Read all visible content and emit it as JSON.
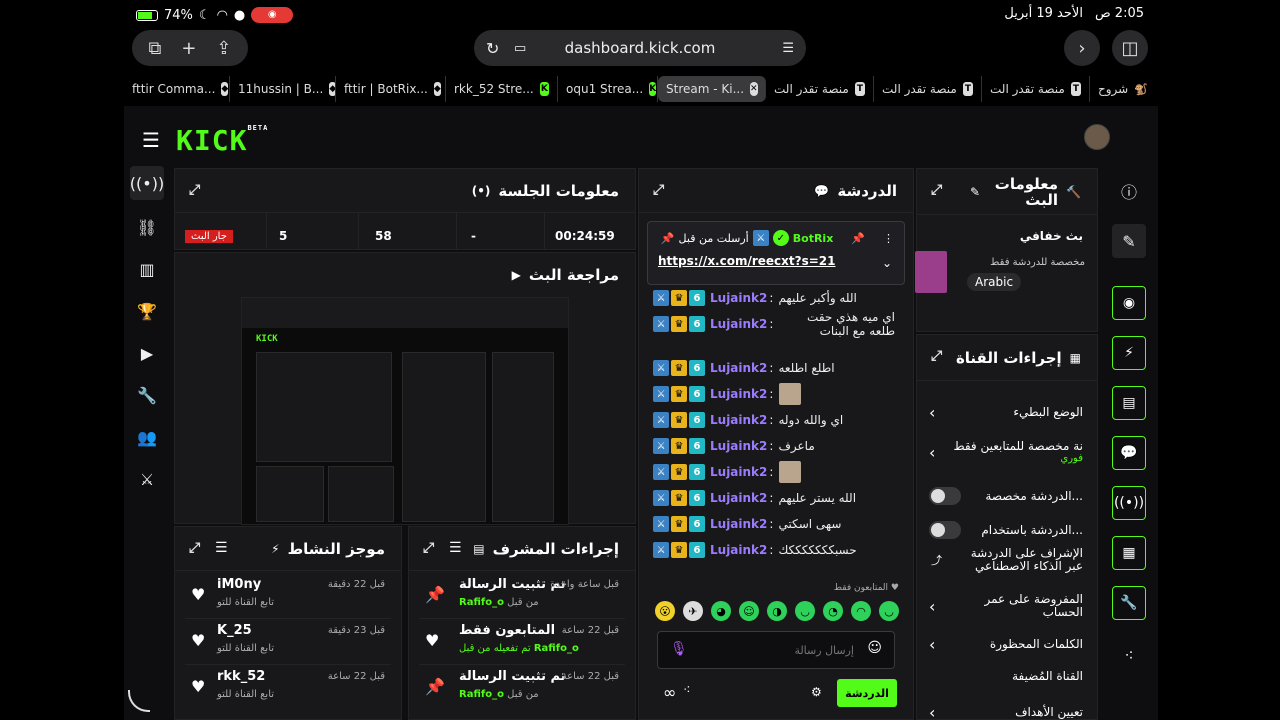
{
  "status": {
    "time": "2:05 ص",
    "date": "الأحد 19 أبريل",
    "battery": "74%"
  },
  "browser": {
    "url": "dashboard.kick.com"
  },
  "tabs": [
    {
      "label": "شروح",
      "icon": "🐒"
    },
    {
      "label": "منصة تقدر الت",
      "icon": "T"
    },
    {
      "label": "منصة تقدر الت",
      "icon": "T"
    },
    {
      "label": "منصة تقدر الت",
      "icon": "T"
    },
    {
      "label": "Stream - Ki...",
      "icon": "x"
    },
    {
      "label": "oqu1 Strea...",
      "icon": "K"
    },
    {
      "label": "rkk_52 Stre...",
      "icon": "K"
    },
    {
      "label": "fttir | BotRix...",
      "icon": "◆"
    },
    {
      "label": "11hussin | B...",
      "icon": "◆"
    },
    {
      "label": "fttir Comma...",
      "icon": "◆"
    }
  ],
  "app": {
    "logo": "KICK",
    "beta": "BETA"
  },
  "session": {
    "title": "معلومات الجلسة",
    "live_badge": "جار البث",
    "viewers": "5",
    "followers": "58",
    "subs": "-",
    "duration": "00:24:59"
  },
  "review": {
    "title": "مراجعة البث"
  },
  "activity": {
    "title": "موجز النشاط",
    "items": [
      {
        "name": "iM0ny",
        "sub": "تابع القناة للتو",
        "time": "قبل 22 دقيقة"
      },
      {
        "name": "K_25",
        "sub": "تابع القناة للتو",
        "time": "قبل 23 دقيقة"
      },
      {
        "name": "rkk_52",
        "sub": "تابع القناة للتو",
        "time": "قبل 22 ساعة"
      }
    ]
  },
  "mod": {
    "title": "إجراءات المشرف",
    "items": [
      {
        "action": "تم تثبيت الرسالة",
        "by": "من قبل",
        "user": "Rafifo_o",
        "time": "قبل ساعة واحدة",
        "icon": "pin"
      },
      {
        "action": "المتابعون فقط",
        "by": "تم تفعيله من قبل",
        "user": "Rafifo_o",
        "time": "قبل 22 ساعة",
        "icon": "heart"
      },
      {
        "action": "تم تثبيت الرسالة",
        "by": "من قبل",
        "user": "Rafifo_o",
        "time": "قبل 22 ساعة",
        "icon": "pin"
      }
    ]
  },
  "chat": {
    "title": "الدردشة",
    "pinned": {
      "user": "BotRix",
      "by": "أرسلت من قبل",
      "link": "https://x.com/reecxt?s=21"
    },
    "messages": [
      {
        "user": "Lujaink2",
        "text": "الله وأكبر عليهم"
      },
      {
        "user": "Lujaink2",
        "text": "اي ميه هذي حقت طلعه مع البنات"
      },
      {
        "user": "Lujaink2",
        "text": "اطلع اطلعه"
      },
      {
        "user": "Lujaink2",
        "text": ""
      },
      {
        "user": "Lujaink2",
        "text": "اي والله دوله"
      },
      {
        "user": "Lujaink2",
        "text": "ماعرف"
      },
      {
        "user": "Lujaink2",
        "text": ""
      },
      {
        "user": "Lujaink2",
        "text": "الله يستر عليهم"
      },
      {
        "user": "Lujaink2",
        "text": "سهى اسكتي"
      },
      {
        "user": "Lujaink2",
        "text": "حسبكككككككك"
      }
    ],
    "followers_only": "المتابعون فقط",
    "placeholder": "إرسال رسالة",
    "send": "الدردشة"
  },
  "stream_info": {
    "title": "معلومات البث",
    "name": "بث خفافي",
    "category": "مخصصة للدردشة فقط",
    "language": "Arabic"
  },
  "channel_actions": {
    "title": "إجراءات القناة",
    "items": [
      {
        "label": "الوضع البطيء",
        "type": "chevron"
      },
      {
        "label": "نة مخصصة للمتابعين فقط",
        "sub": "فوري",
        "type": "chevron"
      },
      {
        "label": "...الدردشة مخصصة",
        "type": "toggle"
      },
      {
        "label": "...الدردشة باستخدام",
        "type": "toggle"
      },
      {
        "label": "الإشراف على الدردشة عبر الذكاء الاصطناعي",
        "type": "link"
      },
      {
        "label": "المفروضة على عمر الحساب",
        "type": "chevron"
      },
      {
        "label": "الكلمات المحظورة",
        "type": "chevron"
      },
      {
        "label": "القناة المُضيفة",
        "type": "none"
      },
      {
        "label": "تعيين الأهداف",
        "type": "chevron"
      }
    ]
  },
  "colors": {
    "accent": "#53fc18",
    "live": "#d41f1f",
    "username": "#9b7cff"
  }
}
